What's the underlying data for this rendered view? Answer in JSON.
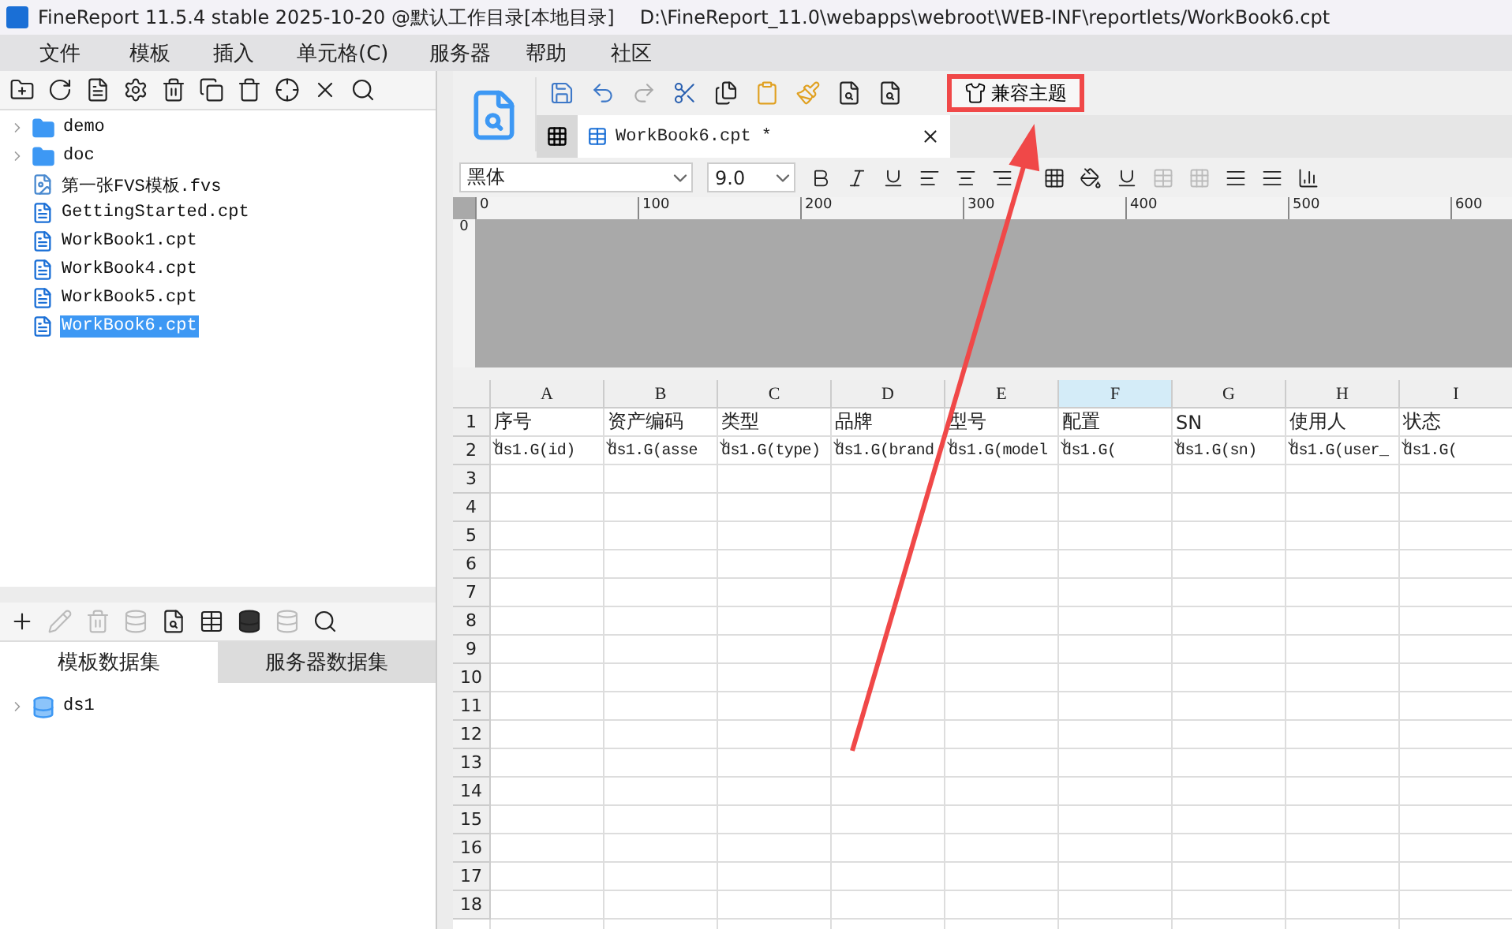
{
  "title_bar": {
    "title": "FineReport 11.5.4 stable 2025-10-20 @默认工作目录[本地目录]",
    "path": "D:\\FineReport_11.0\\webapps\\webroot\\WEB-INF\\reportlets/WorkBook6.cpt"
  },
  "menu": [
    "文件",
    "模板",
    "插入",
    "单元格(C)",
    "服务器",
    "帮助",
    "社区"
  ],
  "file_tree": [
    {
      "label": "demo",
      "kind": "folder",
      "selected": false
    },
    {
      "label": "doc",
      "kind": "folder",
      "selected": false
    },
    {
      "label": "第一张FVS模板.fvs",
      "kind": "fvs",
      "selected": false
    },
    {
      "label": "GettingStarted.cpt",
      "kind": "cpt",
      "selected": false
    },
    {
      "label": "WorkBook1.cpt",
      "kind": "cpt",
      "selected": false
    },
    {
      "label": "WorkBook4.cpt",
      "kind": "cpt",
      "selected": false
    },
    {
      "label": "WorkBook5.cpt",
      "kind": "cpt",
      "selected": false
    },
    {
      "label": "WorkBook6.cpt",
      "kind": "cpt",
      "selected": true
    }
  ],
  "dataset_tabs": [
    {
      "label": "模板数据集",
      "selected": true
    },
    {
      "label": "服务器数据集",
      "selected": false
    }
  ],
  "datasets": [
    {
      "label": "ds1"
    }
  ],
  "theme_button": {
    "label": "兼容主题"
  },
  "doc_tabs": [
    {
      "label": "WorkBook6.cpt *",
      "selected": true
    }
  ],
  "font": {
    "family": "黑体",
    "size": "9.0"
  },
  "ruler": [
    "0",
    "100",
    "200",
    "300",
    "400",
    "500",
    "600"
  ],
  "vruler": "0",
  "columns": [
    {
      "label": "A",
      "selected": false
    },
    {
      "label": "B",
      "selected": false
    },
    {
      "label": "C",
      "selected": false
    },
    {
      "label": "D",
      "selected": false
    },
    {
      "label": "E",
      "selected": false
    },
    {
      "label": "F",
      "selected": true
    },
    {
      "label": "G",
      "selected": false
    },
    {
      "label": "H",
      "selected": false
    },
    {
      "label": "I",
      "selected": false
    }
  ],
  "rows": [
    {
      "number": "1",
      "kind": "header",
      "cells": [
        "序号",
        "资产编码",
        "类型",
        "品牌",
        "型号",
        "配置",
        "SN",
        "使用人",
        "状态"
      ]
    },
    {
      "number": "2",
      "kind": "data",
      "cells": [
        "ds1.G(id)",
        "ds1.G(asse",
        "ds1.G(type)",
        "ds1.G(brand",
        "ds1.G(model",
        "ds1.G(",
        "ds1.G(sn)",
        "ds1.G(user_",
        "ds1.G("
      ]
    },
    {
      "number": "3",
      "kind": "empty",
      "cells": []
    },
    {
      "number": "4",
      "kind": "empty",
      "cells": []
    },
    {
      "number": "5",
      "kind": "empty",
      "cells": []
    },
    {
      "number": "6",
      "kind": "empty",
      "cells": []
    },
    {
      "number": "7",
      "kind": "empty",
      "cells": []
    },
    {
      "number": "8",
      "kind": "empty",
      "cells": []
    },
    {
      "number": "9",
      "kind": "empty",
      "cells": []
    },
    {
      "number": "10",
      "kind": "empty",
      "cells": []
    },
    {
      "number": "11",
      "kind": "empty",
      "cells": []
    },
    {
      "number": "12",
      "kind": "empty",
      "cells": []
    },
    {
      "number": "13",
      "kind": "empty",
      "cells": []
    },
    {
      "number": "14",
      "kind": "empty",
      "cells": []
    },
    {
      "number": "15",
      "kind": "empty",
      "cells": []
    },
    {
      "number": "16",
      "kind": "empty",
      "cells": []
    },
    {
      "number": "17",
      "kind": "empty",
      "cells": []
    },
    {
      "number": "18",
      "kind": "empty",
      "cells": []
    }
  ]
}
